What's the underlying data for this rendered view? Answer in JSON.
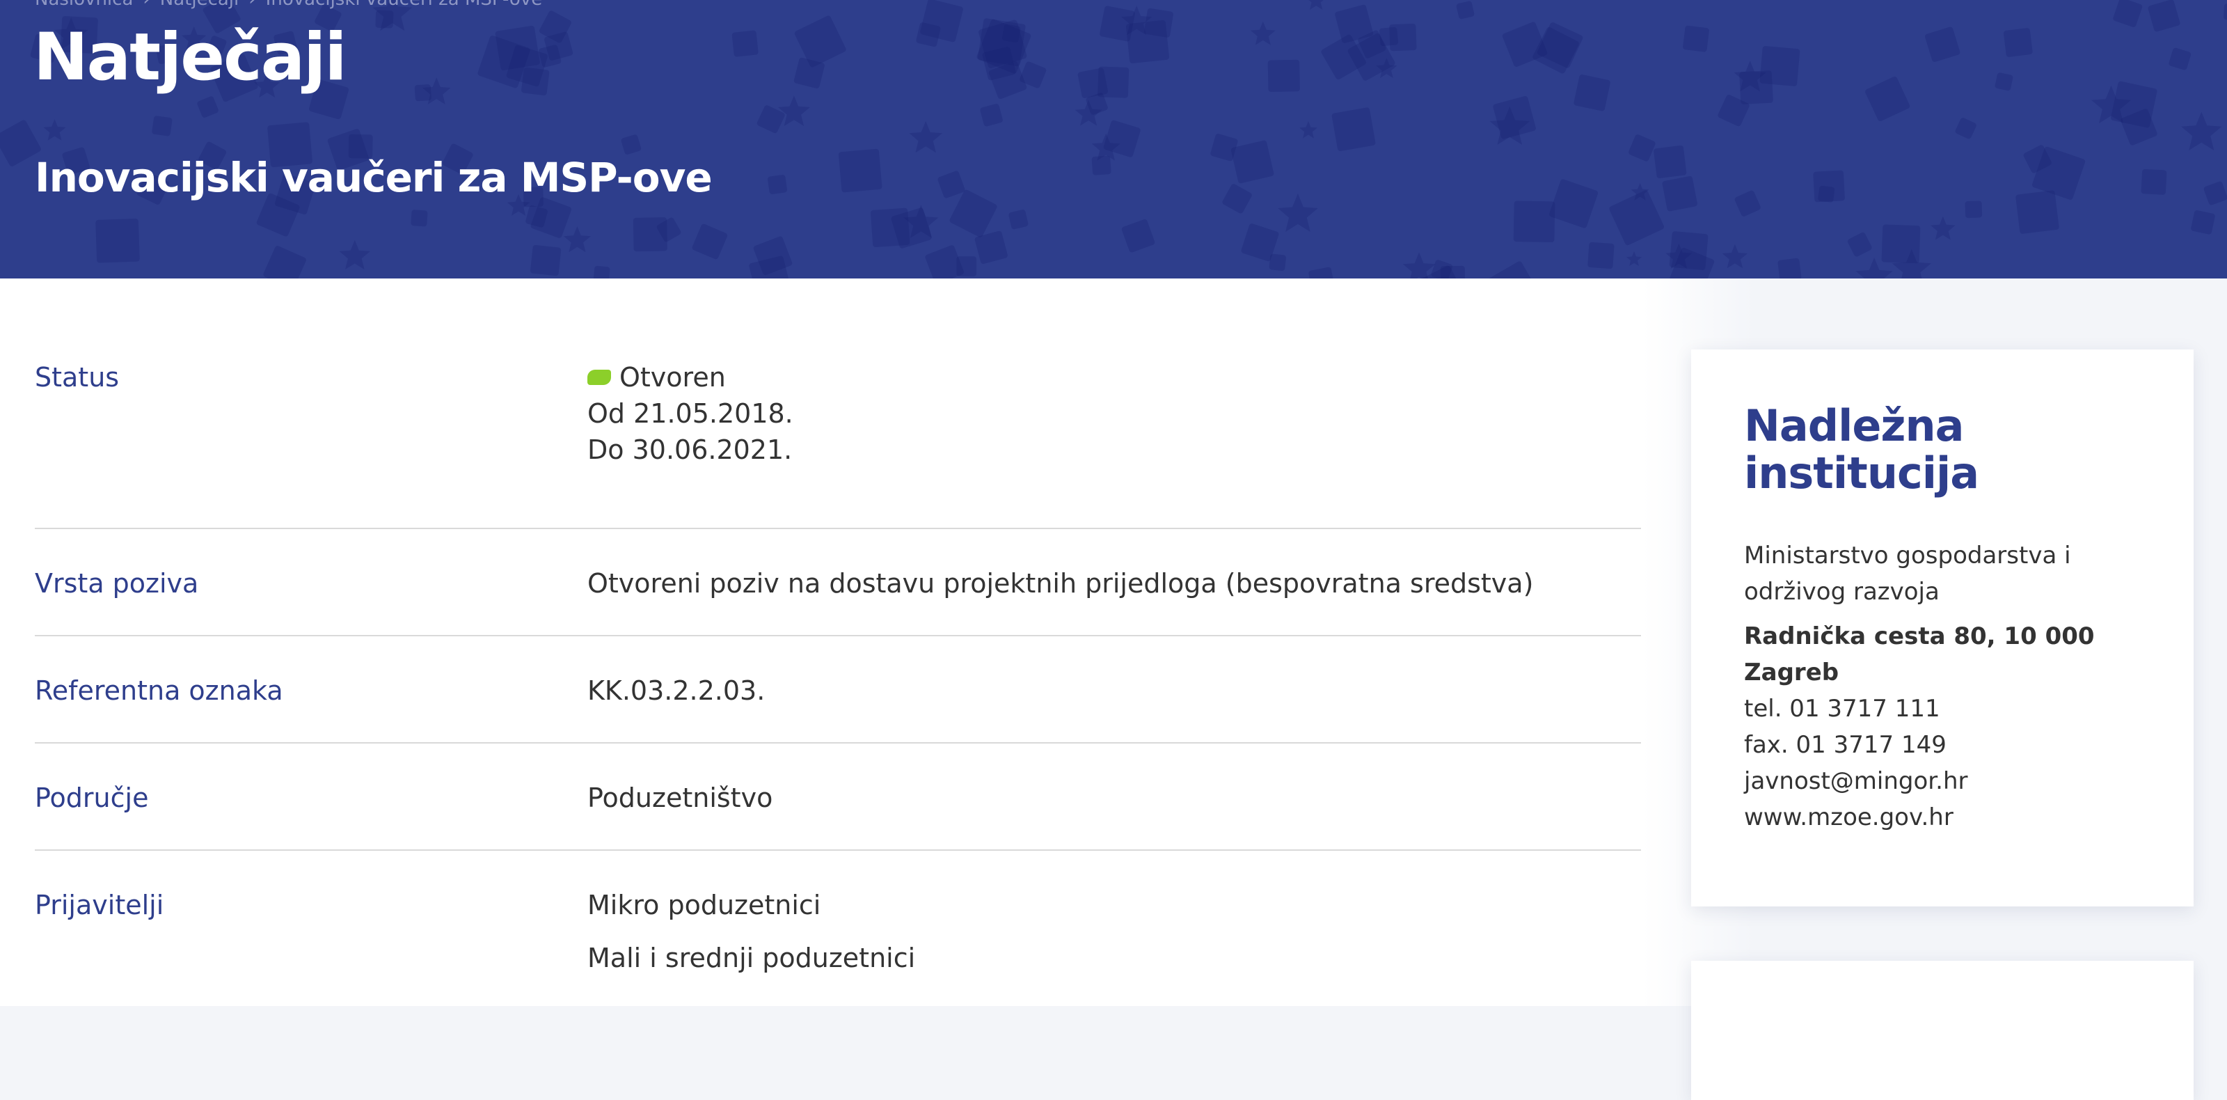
{
  "hero": {
    "breadcrumb": [
      "Naslovnica",
      "Natječaji",
      "Inovacijski vaučeri za MSP-ove"
    ],
    "title": "Natječaji",
    "subtitle": "Inovacijski vaučeri za MSP-ove",
    "background_color": "#2e3e8c"
  },
  "details": {
    "status": {
      "label": "Status",
      "value": "Otvoren",
      "status_color": "#8ccf2a",
      "from": "Od 21.05.2018.",
      "to": "Do 30.06.2021."
    },
    "vrsta_poziva": {
      "label": "Vrsta poziva",
      "value": "Otvoreni poziv na dostavu projektnih prijedloga (bespovratna sredstva)"
    },
    "referentna_oznaka": {
      "label": "Referentna oznaka",
      "value": "KK.03.2.2.03."
    },
    "podrucje": {
      "label": "Područje",
      "value": "Poduzetništvo"
    },
    "prijavitelji": {
      "label": "Prijavitelji",
      "values": [
        "Mikro poduzetnici",
        "Mali i srednji poduzetnici"
      ]
    }
  },
  "institution": {
    "title": "Nadležna institucija",
    "name": "Ministarstvo gospodarstva i održivog razvoja",
    "address": "Radnička cesta 80, 10 000 Zagreb",
    "tel": "tel. 01 3717 111",
    "fax": "fax. 01 3717 149",
    "email": "javnost@mingor.hr",
    "website": "www.mzoe.gov.hr"
  }
}
